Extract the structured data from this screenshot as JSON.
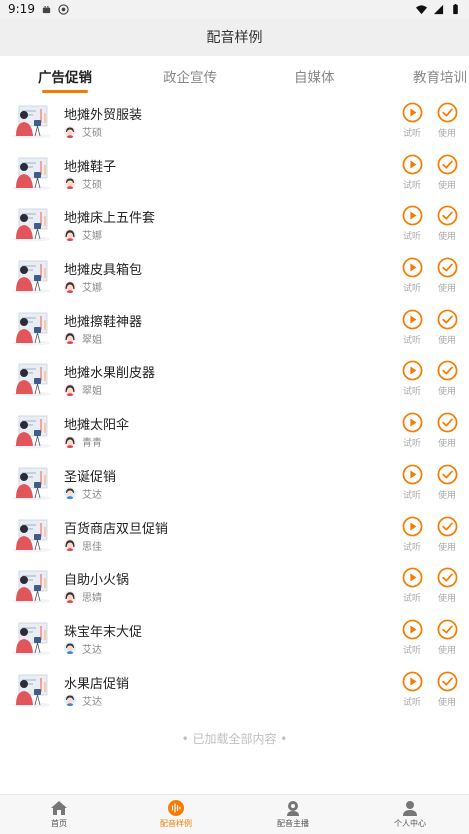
{
  "status_bar": {
    "time": "9:19"
  },
  "header": {
    "title": "配音样例"
  },
  "tabs": [
    {
      "label": "广告促销",
      "active": true
    },
    {
      "label": "政企宣传",
      "active": false
    },
    {
      "label": "自媒体",
      "active": false
    },
    {
      "label": "教育培训",
      "active": false
    }
  ],
  "items": [
    {
      "title": "地摊外贸服装",
      "speaker": "艾硕",
      "avatar": "boy"
    },
    {
      "title": "地摊鞋子",
      "speaker": "艾硕",
      "avatar": "boy"
    },
    {
      "title": "地摊床上五件套",
      "speaker": "艾娜",
      "avatar": "girl"
    },
    {
      "title": "地摊皮具箱包",
      "speaker": "艾娜",
      "avatar": "girl"
    },
    {
      "title": "地摊擦鞋神器",
      "speaker": "翠姐",
      "avatar": "girl"
    },
    {
      "title": "地摊水果削皮器",
      "speaker": "翠姐",
      "avatar": "girl"
    },
    {
      "title": "地摊太阳伞",
      "speaker": "青青",
      "avatar": "girl"
    },
    {
      "title": "圣诞促销",
      "speaker": "艾达",
      "avatar": "boy-blue"
    },
    {
      "title": "百货商店双旦促销",
      "speaker": "思佳",
      "avatar": "girl"
    },
    {
      "title": "自助小火锅",
      "speaker": "思婧",
      "avatar": "girl"
    },
    {
      "title": "珠宝年末大促",
      "speaker": "艾达",
      "avatar": "boy-blue"
    },
    {
      "title": "水果店促销",
      "speaker": "艾达",
      "avatar": "boy-blue"
    }
  ],
  "actions": {
    "listen_label": "试听",
    "use_label": "使用"
  },
  "footer_note": "• 已加载全部内容 •",
  "bottom_nav": [
    {
      "label": "首页",
      "icon": "home-icon",
      "active": false
    },
    {
      "label": "配音样例",
      "icon": "soundwave-icon",
      "active": true
    },
    {
      "label": "配音主播",
      "icon": "anchor-icon",
      "active": false
    },
    {
      "label": "个人中心",
      "icon": "person-icon",
      "active": false
    }
  ],
  "colors": {
    "accent": "#f57c00",
    "title_bar": "#efefef"
  }
}
